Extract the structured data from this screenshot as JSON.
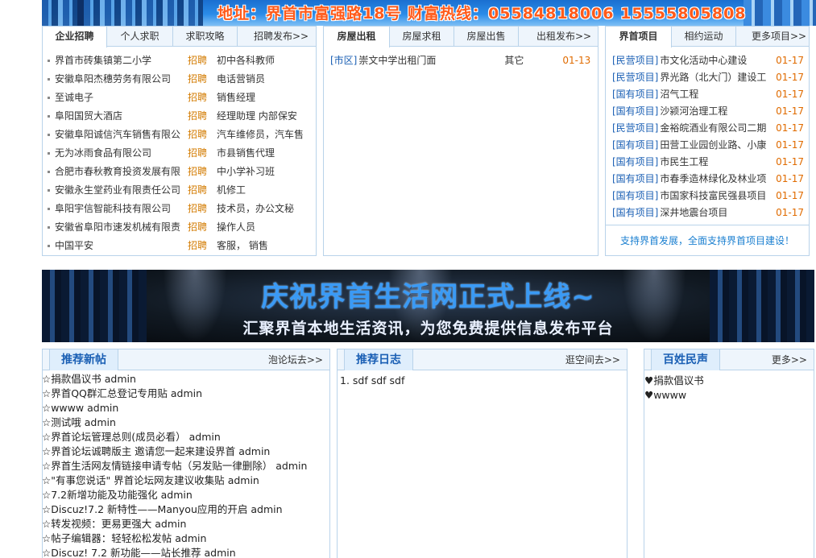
{
  "banner": {
    "address_line": "地址：界首市富强路18号  财富热线：05584818006  15555805808"
  },
  "jobs": {
    "tabs": [
      "企业招聘",
      "个人求职",
      "求职攻略"
    ],
    "more": "招聘发布>>",
    "tag": "招聘",
    "items": [
      {
        "company": "界首市砖集镇第二小学",
        "position": "初中各科教师"
      },
      {
        "company": "安徽阜阳杰穗劳务有限公司",
        "position": "电话营销员"
      },
      {
        "company": "至诚电子",
        "position": "销售经理"
      },
      {
        "company": "阜阳国贸大酒店",
        "position": "经理助理  内部保安"
      },
      {
        "company": "安徽阜阳诚信汽车销售有限公",
        "position": "汽车维修员，汽车售"
      },
      {
        "company": "无为冰雨食品有限公司",
        "position": "市县销售代理"
      },
      {
        "company": "合肥市春秋教育投资发展有限",
        "position": "中小学补习班"
      },
      {
        "company": "安徽永生堂药业有限责任公司",
        "position": "机修工"
      },
      {
        "company": "阜阳宇信智能科技有限公司",
        "position": "技术员，办公文秘"
      },
      {
        "company": "安徽省阜阳市速发机械有限责",
        "position": "操作人员"
      },
      {
        "company": "中国平安",
        "position": "客服， 销售"
      }
    ]
  },
  "housing": {
    "tabs": [
      "房屋出租",
      "房屋求租",
      "房屋出售"
    ],
    "more": "出租发布>>",
    "items": [
      {
        "area": "[市区]",
        "title": "崇文中学出租门面",
        "type": "其它",
        "date": "01-13"
      }
    ]
  },
  "projects": {
    "tabs": [
      "界首项目",
      "相约运动"
    ],
    "more": "更多项目>>",
    "items": [
      {
        "type": "[民营项目]",
        "title": "市文化活动中心建设",
        "date": "01-17"
      },
      {
        "type": "[民营项目]",
        "title": "界光路（北大门）建设工",
        "date": "01-17"
      },
      {
        "type": "[国有项目]",
        "title": "沼气工程",
        "date": "01-17"
      },
      {
        "type": "[国有项目]",
        "title": "沙颍河治理工程",
        "date": "01-17"
      },
      {
        "type": "[民营项目]",
        "title": "金裕皖酒业有限公司二期",
        "date": "01-17"
      },
      {
        "type": "[国有项目]",
        "title": "田营工业园创业路、小康",
        "date": "01-17"
      },
      {
        "type": "[国有项目]",
        "title": "市民生工程",
        "date": "01-17"
      },
      {
        "type": "[国有项目]",
        "title": "市春季造林绿化及林业项",
        "date": "01-17"
      },
      {
        "type": "[国有项目]",
        "title": "市国家科技富民强县项目",
        "date": "01-17"
      },
      {
        "type": "[国有项目]",
        "title": "深井地震台项目",
        "date": "01-17"
      }
    ],
    "footer": "支持界首发展，全面支持界首项目建设！"
  },
  "mid_banner": {
    "headline": "庆祝界首生活网正式上线~",
    "subline": "汇聚界首本地生活资讯，为您免费提供信息发布平台"
  },
  "posts": {
    "title": "推荐新帖",
    "more": "泡论坛去>>",
    "items": [
      {
        "title": "☆捐款倡议书",
        "author": "admin"
      },
      {
        "title": "☆界首QQ群汇总登记专用贴",
        "author": "admin"
      },
      {
        "title": "☆wwww",
        "author": "admin"
      },
      {
        "title": "☆测试哦",
        "author": "admin"
      },
      {
        "title": "☆界首论坛管理总则(成员必看）",
        "author": "admin"
      },
      {
        "title": "☆界首论坛诚聘版主 邀请您一起来建设界首",
        "author": "admin"
      },
      {
        "title": "☆界首生活网友情链接申请专帖（另发贴一律删除）",
        "author": "admin"
      },
      {
        "title": "☆\"有事您说话\" 界首论坛网友建议收集贴",
        "author": "admin"
      },
      {
        "title": "☆7.2新增功能及功能强化",
        "author": "admin"
      },
      {
        "title": "☆Discuz!7.2 新特性——Manyou应用的开启",
        "author": "admin"
      },
      {
        "title": "☆转发视频：更易更强大",
        "author": "admin"
      },
      {
        "title": "☆帖子编辑器：轻轻松松发帖",
        "author": "admin"
      },
      {
        "title": "☆Discuz! 7.2 新功能——站长推荐",
        "author": "admin"
      }
    ]
  },
  "blogs": {
    "title": "推荐日志",
    "more": "逛空间去>>",
    "items": [
      {
        "title": "1. sdf sdf sdf"
      }
    ]
  },
  "voice": {
    "title": "百姓民声",
    "more": "更多>>",
    "items": [
      {
        "title": "♥捐款倡议书"
      },
      {
        "title": "♥wwww"
      }
    ]
  },
  "colors": {
    "accent_blue": "#1a5fb4",
    "job_tag_orange": "#d37b00",
    "date_orange": "#e06b00",
    "border": "#b9d3ea"
  }
}
